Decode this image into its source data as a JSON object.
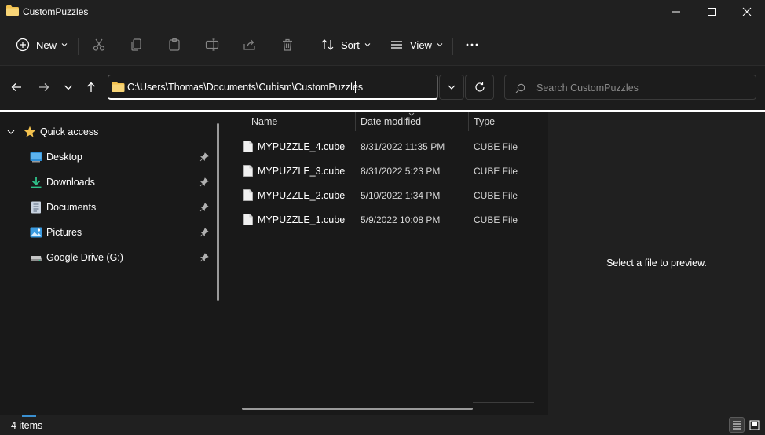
{
  "window": {
    "title": "CustomPuzzles",
    "colors": {
      "accent": "#3a8fd0",
      "folder": "#f2c14e",
      "background": "#191919"
    }
  },
  "commandbar": {
    "new_label": "New",
    "sort_label": "Sort",
    "view_label": "View",
    "icons": [
      "plus-circle-icon",
      "cut-icon",
      "copy-icon",
      "paste-icon",
      "rename-icon",
      "share-icon",
      "delete-icon",
      "sort-icon",
      "view-icon",
      "more-icon"
    ]
  },
  "address": {
    "path": "C:\\Users\\Thomas\\Documents\\Cubism\\CustomPuzzles",
    "search_placeholder": "Search CustomPuzzles"
  },
  "navigation": {
    "quick_access_label": "Quick access",
    "items": [
      {
        "label": "Desktop",
        "icon": "desktop-icon",
        "pinned": true
      },
      {
        "label": "Downloads",
        "icon": "downloads-icon",
        "pinned": true
      },
      {
        "label": "Documents",
        "icon": "documents-icon",
        "pinned": true
      },
      {
        "label": "Pictures",
        "icon": "pictures-icon",
        "pinned": true
      },
      {
        "label": "Google Drive (G:)",
        "icon": "drive-icon",
        "pinned": true
      }
    ]
  },
  "files": {
    "columns": {
      "name": "Name",
      "date": "Date modified",
      "type": "Type"
    },
    "rows": [
      {
        "name": "MYPUZZLE_4.cube",
        "date": "8/31/2022 11:35 PM",
        "type": "CUBE File"
      },
      {
        "name": "MYPUZZLE_3.cube",
        "date": "8/31/2022 5:23 PM",
        "type": "CUBE File"
      },
      {
        "name": "MYPUZZLE_2.cube",
        "date": "5/10/2022 1:34 PM",
        "type": "CUBE File"
      },
      {
        "name": "MYPUZZLE_1.cube",
        "date": "5/9/2022 10:08 PM",
        "type": "CUBE File"
      }
    ]
  },
  "preview": {
    "message": "Select a file to preview."
  },
  "statusbar": {
    "item_count": "4 items"
  }
}
